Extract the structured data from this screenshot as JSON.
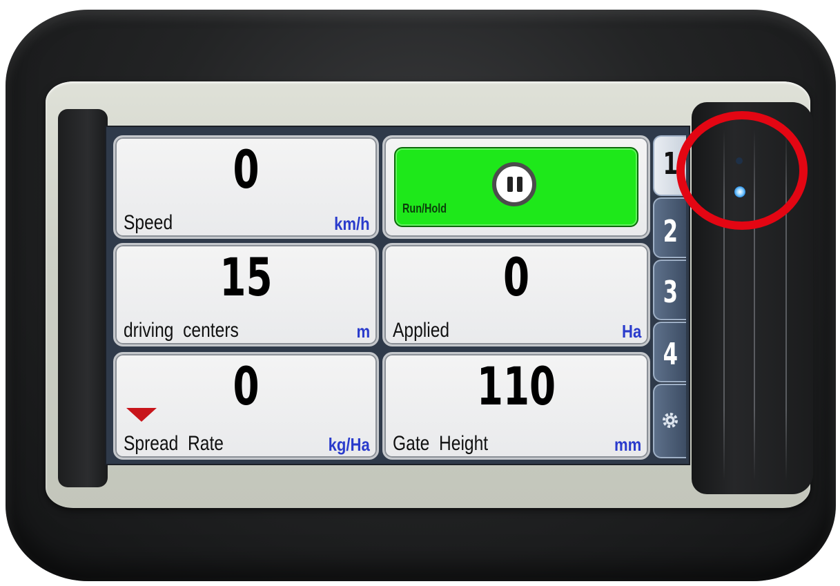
{
  "tiles": {
    "speed": {
      "value": "0",
      "label": "Speed",
      "unit": "km/h"
    },
    "driving": {
      "value": "15",
      "label": "driving  centers",
      "unit": "m"
    },
    "spread": {
      "value": "0",
      "label": "Spread  Rate",
      "unit": "kg/Ha"
    },
    "run": {
      "label": "Run/Hold"
    },
    "applied": {
      "value": "0",
      "label": "Applied",
      "unit": "Ha"
    },
    "gate": {
      "value": "110",
      "label": "Gate  Height",
      "unit": "mm"
    }
  },
  "tabs": [
    "1",
    "2",
    "3",
    "4"
  ],
  "colors": {
    "run_green": "#1ee81a",
    "unit_blue": "#2a3bcc",
    "indicator_red": "#c8151b",
    "highlight_circle": "#e30613",
    "led_blue": "#1e88e5"
  },
  "icons": [
    "pause-icon",
    "gear-icon",
    "decrease-triangle-icon",
    "status-led"
  ]
}
